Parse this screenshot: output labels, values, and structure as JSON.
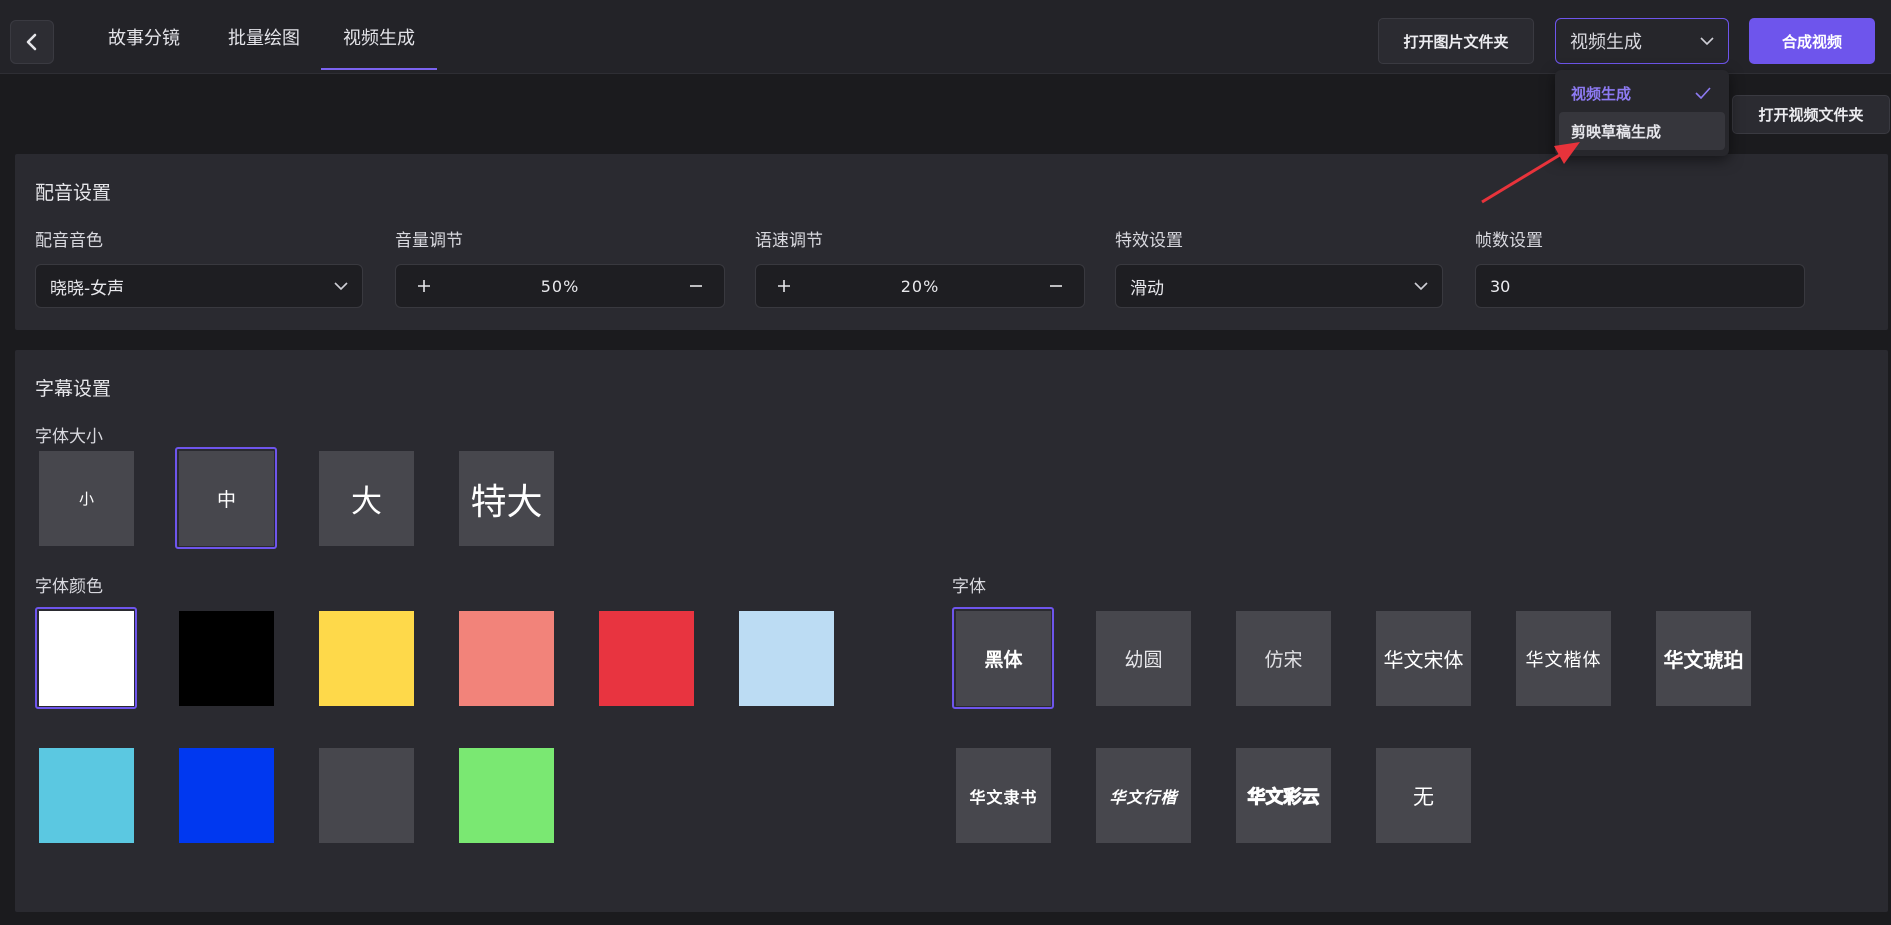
{
  "header": {
    "tabs": [
      {
        "label": "故事分镜"
      },
      {
        "label": "批量绘图"
      },
      {
        "label": "视频生成"
      }
    ],
    "active_tab": "视频生成",
    "open_image_folder": "打开图片文件夹",
    "mode_select_value": "视频生成",
    "compose_video": "合成视频",
    "open_video_folder": "打开视频文件夹"
  },
  "dropdown": {
    "options": [
      {
        "label": "视频生成",
        "selected": true
      },
      {
        "label": "剪映草稿生成",
        "selected": false
      }
    ]
  },
  "voice": {
    "title": "配音设置",
    "timbre_label": "配音音色",
    "timbre_value": "晓晓-女声",
    "volume_label": "音量调节",
    "volume_value": "50%",
    "speed_label": "语速调节",
    "speed_value": "20%",
    "effect_label": "特效设置",
    "effect_value": "滑动",
    "fps_label": "帧数设置",
    "fps_value": "30"
  },
  "subtitle": {
    "title": "字幕设置",
    "size_label": "字体大小",
    "sizes": [
      "小",
      "中",
      "大",
      "特大"
    ],
    "selected_size": "中",
    "color_label": "字体颜色",
    "colors": [
      "#ffffff",
      "#000000",
      "#fed94a",
      "#f2837a",
      "#e83440",
      "#bcdcf3",
      "#5bc8e1",
      "#0038f0",
      "#47474d",
      "#7ae872"
    ],
    "selected_color": "#ffffff",
    "font_label": "字体",
    "fonts": [
      "黑体",
      "幼圆",
      "仿宋",
      "华文宋体",
      "华文楷体",
      "华文琥珀",
      "华文隶书",
      "华文行楷",
      "华文彩云",
      "无"
    ],
    "selected_font": "黑体"
  },
  "accent_color": "#6e55ec",
  "annotation_color": "#e8333b"
}
